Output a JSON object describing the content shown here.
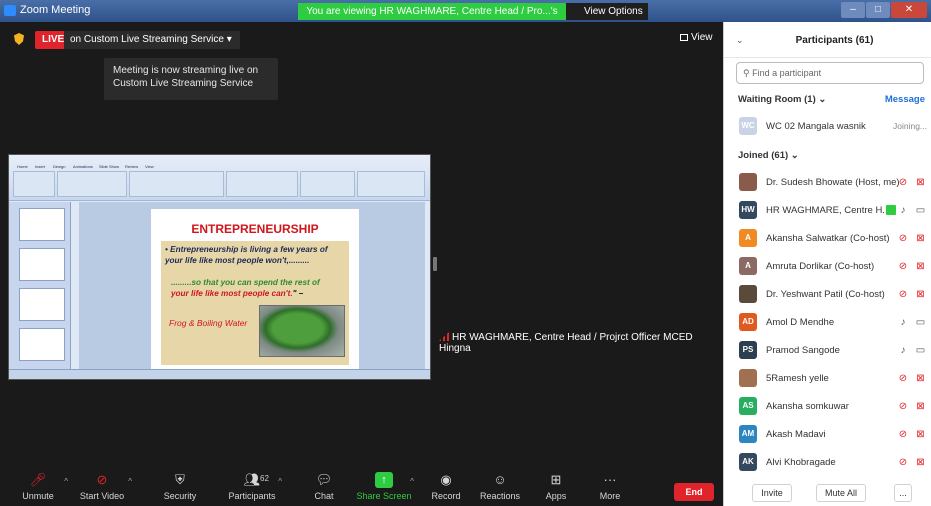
{
  "titlebar": {
    "title": "Zoom Meeting",
    "viewing_banner": "You are viewing HR WAGHMARE, Centre Head / Pro...'s screen",
    "view_options": "View Options ⌄",
    "minimize": "–",
    "maximize": "□",
    "close": "✕"
  },
  "meeting": {
    "live_badge": "LIVE",
    "live_service": "on Custom Live Streaming Service ▾",
    "view_label": "View",
    "tooltip": "Meeting is now streaming live on Custom Live Streaming Service",
    "presenter_label": "HR WAGHMARE, Centre Head / Projrct Officer MCED Hingna"
  },
  "slide": {
    "title": "ENTREPRENEURSHIP",
    "line1": "• Entrepreneurship is living a few years of your life like most people won't,.........",
    "line2_a": ".........so that you can spend the rest of",
    "line2_b": "your life ",
    "line2_c": "like most people can't.",
    "line2_d": "\" –",
    "caption": "Frog & Boiling Water"
  },
  "toolbar": {
    "unmute": "Unmute",
    "start_video": "Start Video",
    "security": "Security",
    "participants": "Participants",
    "participants_count": "62",
    "chat": "Chat",
    "share_screen": "Share Screen",
    "record": "Record",
    "reactions": "Reactions",
    "apps": "Apps",
    "more": "More",
    "end": "End"
  },
  "panel": {
    "title": "Participants (61)",
    "search_placeholder": "Find a participant",
    "waiting_room": "Waiting Room (1) ⌄",
    "message": "Message",
    "waiting": [
      {
        "initials": "WC",
        "name": "WC 02 Mangala wasnik",
        "status": "Joining...",
        "color": "#c9d3e6"
      }
    ],
    "joined_label": "Joined (61) ⌄",
    "joined": [
      {
        "initials": "",
        "name": "Dr. Sudesh Bhowate (Host, me)",
        "color": "#8a5a4a",
        "mic": "muted",
        "cam": "off"
      },
      {
        "initials": "HW",
        "name": "HR WAGHMARE, Centre H...",
        "color": "#34495e",
        "mic": "on",
        "cam": "on"
      },
      {
        "initials": "A",
        "name": "Akansha Salwatkar (Co-host)",
        "color": "#f08a24",
        "mic": "muted",
        "cam": "off"
      },
      {
        "initials": "A",
        "name": "Amruta Dorlikar (Co-host)",
        "color": "#8a6a62",
        "mic": "muted",
        "cam": "off"
      },
      {
        "initials": "",
        "name": "Dr. Yeshwant Patil (Co-host)",
        "color": "#5a4a3a",
        "mic": "muted",
        "cam": "off"
      },
      {
        "initials": "AD",
        "name": "Amol  D Mendhe",
        "color": "#e05a1f",
        "mic": "on",
        "cam": "on"
      },
      {
        "initials": "PS",
        "name": "Pramod Sangode",
        "color": "#2c3e50",
        "mic": "on",
        "cam": "on"
      },
      {
        "initials": "",
        "name": "5Ramesh yelle",
        "color": "#a07050",
        "mic": "muted",
        "cam": "off"
      },
      {
        "initials": "AS",
        "name": "Akansha  somkuwar",
        "color": "#27ae60",
        "mic": "muted",
        "cam": "off"
      },
      {
        "initials": "AM",
        "name": "Akash Madavi",
        "color": "#2e86c1",
        "mic": "muted",
        "cam": "off"
      },
      {
        "initials": "AK",
        "name": "Alvi Khobragade",
        "color": "#34495e",
        "mic": "muted",
        "cam": "off"
      }
    ],
    "invite": "Invite",
    "mute_all": "Mute All",
    "more": "..."
  }
}
